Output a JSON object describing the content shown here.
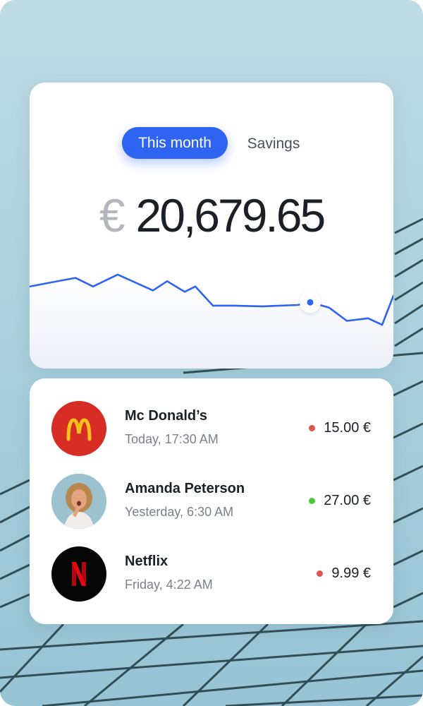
{
  "tabs": {
    "active_label": "This month",
    "inactive_label": "Savings"
  },
  "balance": {
    "currency_symbol": "€",
    "amount": "20,679.65"
  },
  "colors": {
    "accent": "#2f63f1",
    "negative": "#e05552",
    "positive": "#4cc83a"
  },
  "chart_data": {
    "type": "line",
    "series": [
      {
        "values": [
          0.3,
          0.36,
          0.43,
          0.3,
          0.48,
          0.24,
          0.38,
          0.22,
          0.3,
          0.01,
          0.01,
          0.0,
          0.02,
          0.06,
          -0.02,
          -0.22,
          -0.18,
          -0.28,
          0.16
        ]
      }
    ],
    "highlight_index": 13,
    "grid": false
  },
  "transactions": [
    {
      "name": "Mc Donald’s",
      "time": "Today, 17:30 AM",
      "amount": "15.00 €",
      "status": "negative",
      "icon": "mcdonalds-logo-icon"
    },
    {
      "name": "Amanda Peterson",
      "time": "Yesterday, 6:30 AM",
      "amount": "27.00 €",
      "status": "positive",
      "icon": "person-avatar"
    },
    {
      "name": "Netflix",
      "time": "Friday, 4:22 AM",
      "amount": "9.99 €",
      "status": "negative",
      "icon": "netflix-logo-icon"
    }
  ]
}
